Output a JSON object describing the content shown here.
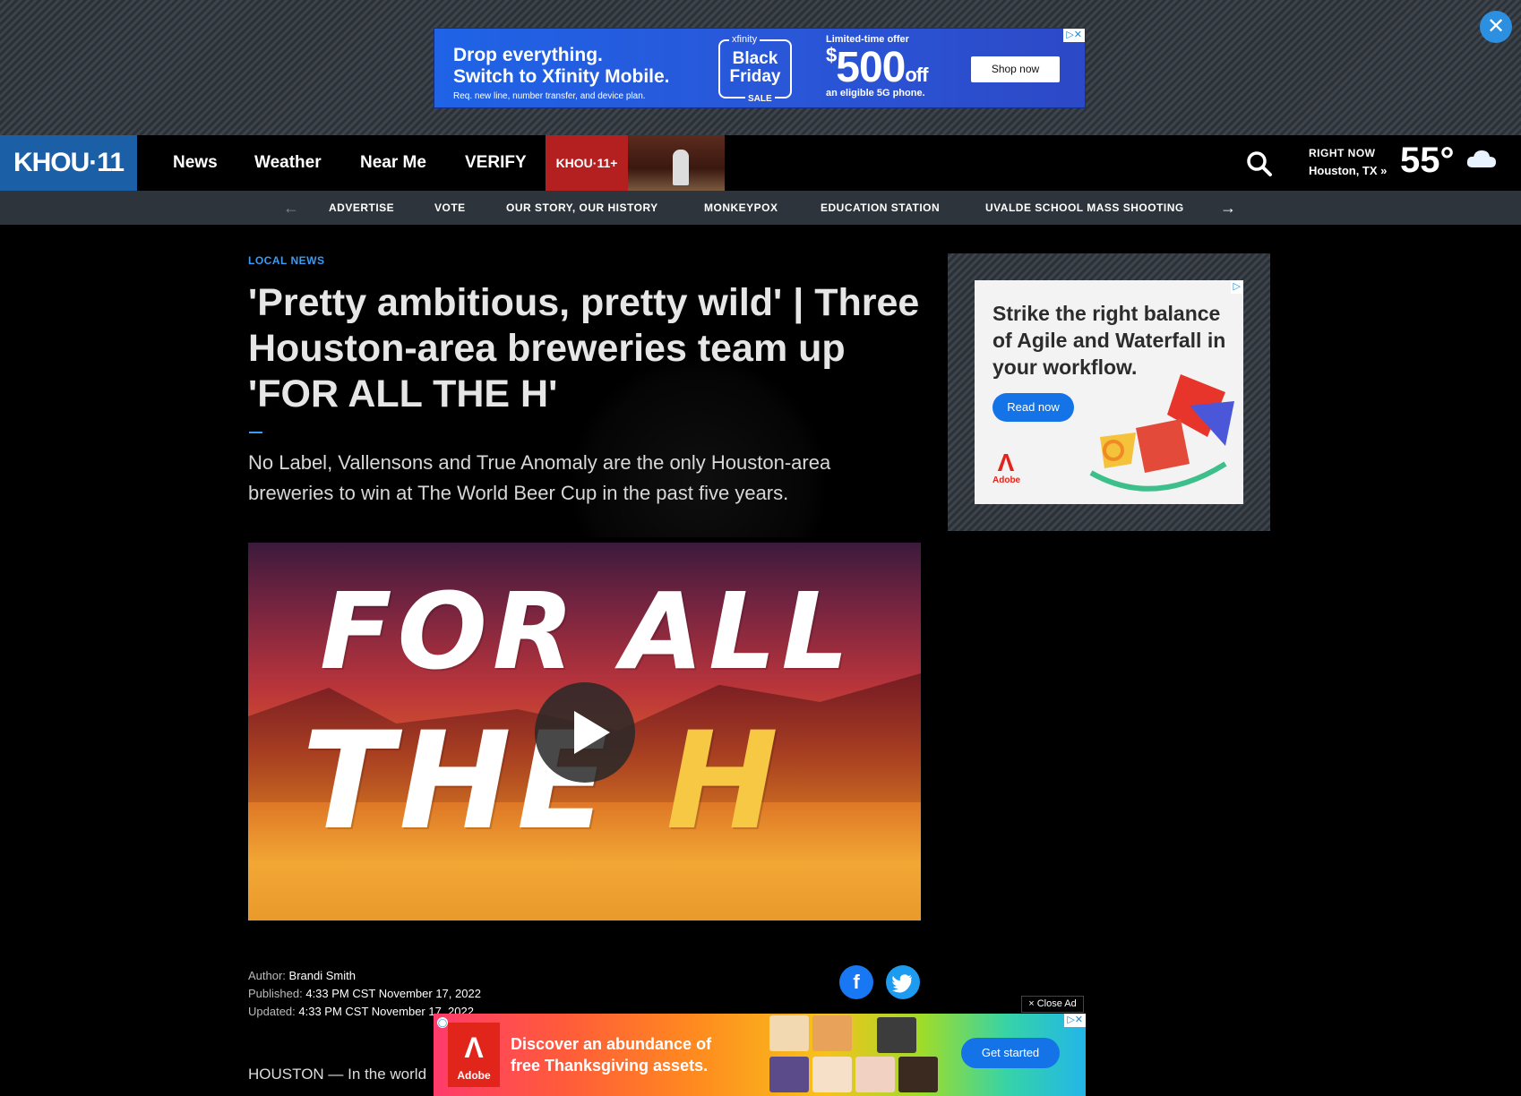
{
  "top_ad": {
    "headline_line1": "Drop everything.",
    "headline_line2": "Switch to Xfinity Mobile.",
    "fine_print": "Req. new line, number transfer, and device plan.",
    "brand": "xfinity",
    "bf_line1": "Black",
    "bf_line2": "Friday",
    "bf_sale": "SALE",
    "offer_label": "Limited-time offer",
    "amount_dollar": "$",
    "amount": "500",
    "amount_suffix": "off",
    "phone_note": "an eligible 5G phone.",
    "cta": "Shop now",
    "close_icon": "close-icon"
  },
  "nav": {
    "logo": "KHOU·11",
    "items": [
      "News",
      "Weather",
      "Near Me",
      "VERIFY"
    ],
    "plus_label": "KHOU·11+",
    "right_now_label": "RIGHT NOW",
    "location": "Houston, TX »",
    "temperature": "55°",
    "weather_icon": "cloud-icon"
  },
  "subnav": {
    "items": [
      "ADVERTISE",
      "VOTE",
      "OUR STORY, OUR HISTORY",
      "MONKEYPOX",
      "EDUCATION STATION",
      "UVALDE SCHOOL MASS SHOOTING"
    ]
  },
  "article": {
    "kicker": "LOCAL NEWS",
    "headline": "'Pretty ambitious, pretty wild' | Three Houston-area breweries team up 'FOR ALL THE H'",
    "dek": "No Label, Vallensons and True Anomaly are the only Houston-area breweries to win at The World Beer Cup in the past five years.",
    "video_title_line1": "FOR ALL",
    "video_title_line2_a": "THE ",
    "video_title_line2_b": "H",
    "author_label": "Author:",
    "author": "Brandi Smith",
    "published_label": "Published:",
    "published": "4:33 PM CST November 17, 2022",
    "updated_label": "Updated:",
    "updated": "4:33 PM CST November 17, 2022",
    "body_start": "HOUSTON — In the world"
  },
  "rail_ad": {
    "title": "Strike the right balance of Agile and Waterfall in your workflow.",
    "cta": "Read now",
    "brand": "Adobe"
  },
  "bottom_ad": {
    "close_label": "× Close Ad",
    "message": "Discover an abundance of free Thanksgiving assets.",
    "cta": "Get started",
    "brand": "Adobe"
  },
  "colors": {
    "brand_blue": "#1b5fa7",
    "plus_red": "#b41f1f",
    "accent": "#3b9bf5",
    "subnav_bg": "#2d343c"
  }
}
